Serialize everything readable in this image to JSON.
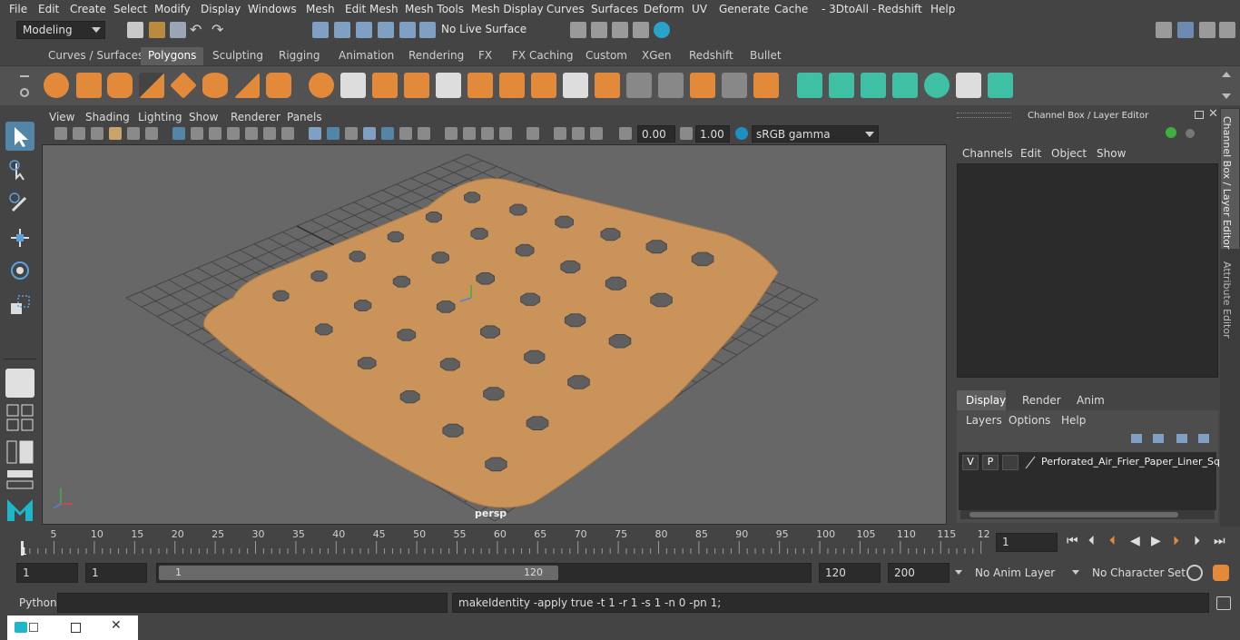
{
  "menubar": {
    "items": [
      "File",
      "Edit",
      "Create",
      "Select",
      "Modify",
      "Display",
      "Windows",
      "Mesh",
      "Edit Mesh",
      "Mesh Tools",
      "Mesh Display",
      "Curves",
      "Surfaces",
      "Deform",
      "UV",
      "Generate",
      "Cache",
      "- 3DtoAll -",
      "Redshift",
      "Help"
    ]
  },
  "status_line": {
    "mode": "Modeling",
    "live_surface": "No Live Surface"
  },
  "shelf": {
    "tabs": [
      "Curves / Surfaces",
      "Polygons",
      "Sculpting",
      "Rigging",
      "Animation",
      "Rendering",
      "FX",
      "FX Caching",
      "Custom",
      "XGen",
      "Redshift",
      "Bullet"
    ],
    "active_tab": "Polygons"
  },
  "viewport": {
    "menu": [
      "View",
      "Shading",
      "Lighting",
      "Show",
      "Renderer",
      "Panels"
    ],
    "exposure": "0.00",
    "gamma": "1.00",
    "color_space": "sRGB gamma",
    "camera_label": "persp"
  },
  "channel_box": {
    "title": "Channel Box / Layer Editor",
    "menu": [
      "Channels",
      "Edit",
      "Object",
      "Show"
    ],
    "layer_tabs": [
      "Display",
      "Render",
      "Anim"
    ],
    "active_layer_tab": "Display",
    "layer_menu": [
      "Layers",
      "Options",
      "Help"
    ],
    "layer_row": {
      "v": "V",
      "p": "P",
      "name": "Perforated_Air_Frier_Paper_Liner_Squ"
    }
  },
  "side_tabs": [
    "Channel Box / Layer Editor",
    "Attribute Editor"
  ],
  "timeline": {
    "ticks": [
      "5",
      "10",
      "15",
      "20",
      "25",
      "30",
      "35",
      "40",
      "45",
      "50",
      "55",
      "60",
      "65",
      "70",
      "75",
      "80",
      "85",
      "90",
      "95",
      "100",
      "105",
      "110",
      "115",
      "12"
    ],
    "start_marker": "1",
    "current_frame": "1"
  },
  "range": {
    "start": "1",
    "playback_start": "1",
    "slider_start": "1",
    "slider_end": "120",
    "playback_end": "120",
    "end": "200",
    "anim_layer": "No Anim Layer",
    "character_set": "No Character Set"
  },
  "command": {
    "language": "Python",
    "output": "makeIdentity -apply true -t 1 -r 1 -s 1 -n 0 -pn 1;"
  },
  "colors": {
    "ui_bg": "#444444",
    "viewport_bg": "#676767",
    "liner": "#c9935a",
    "grid": "#3e3e3e",
    "highlight": "#5285a6",
    "shelf_orange": "#e3893a",
    "shelf_teal": "#3fbfa4"
  }
}
